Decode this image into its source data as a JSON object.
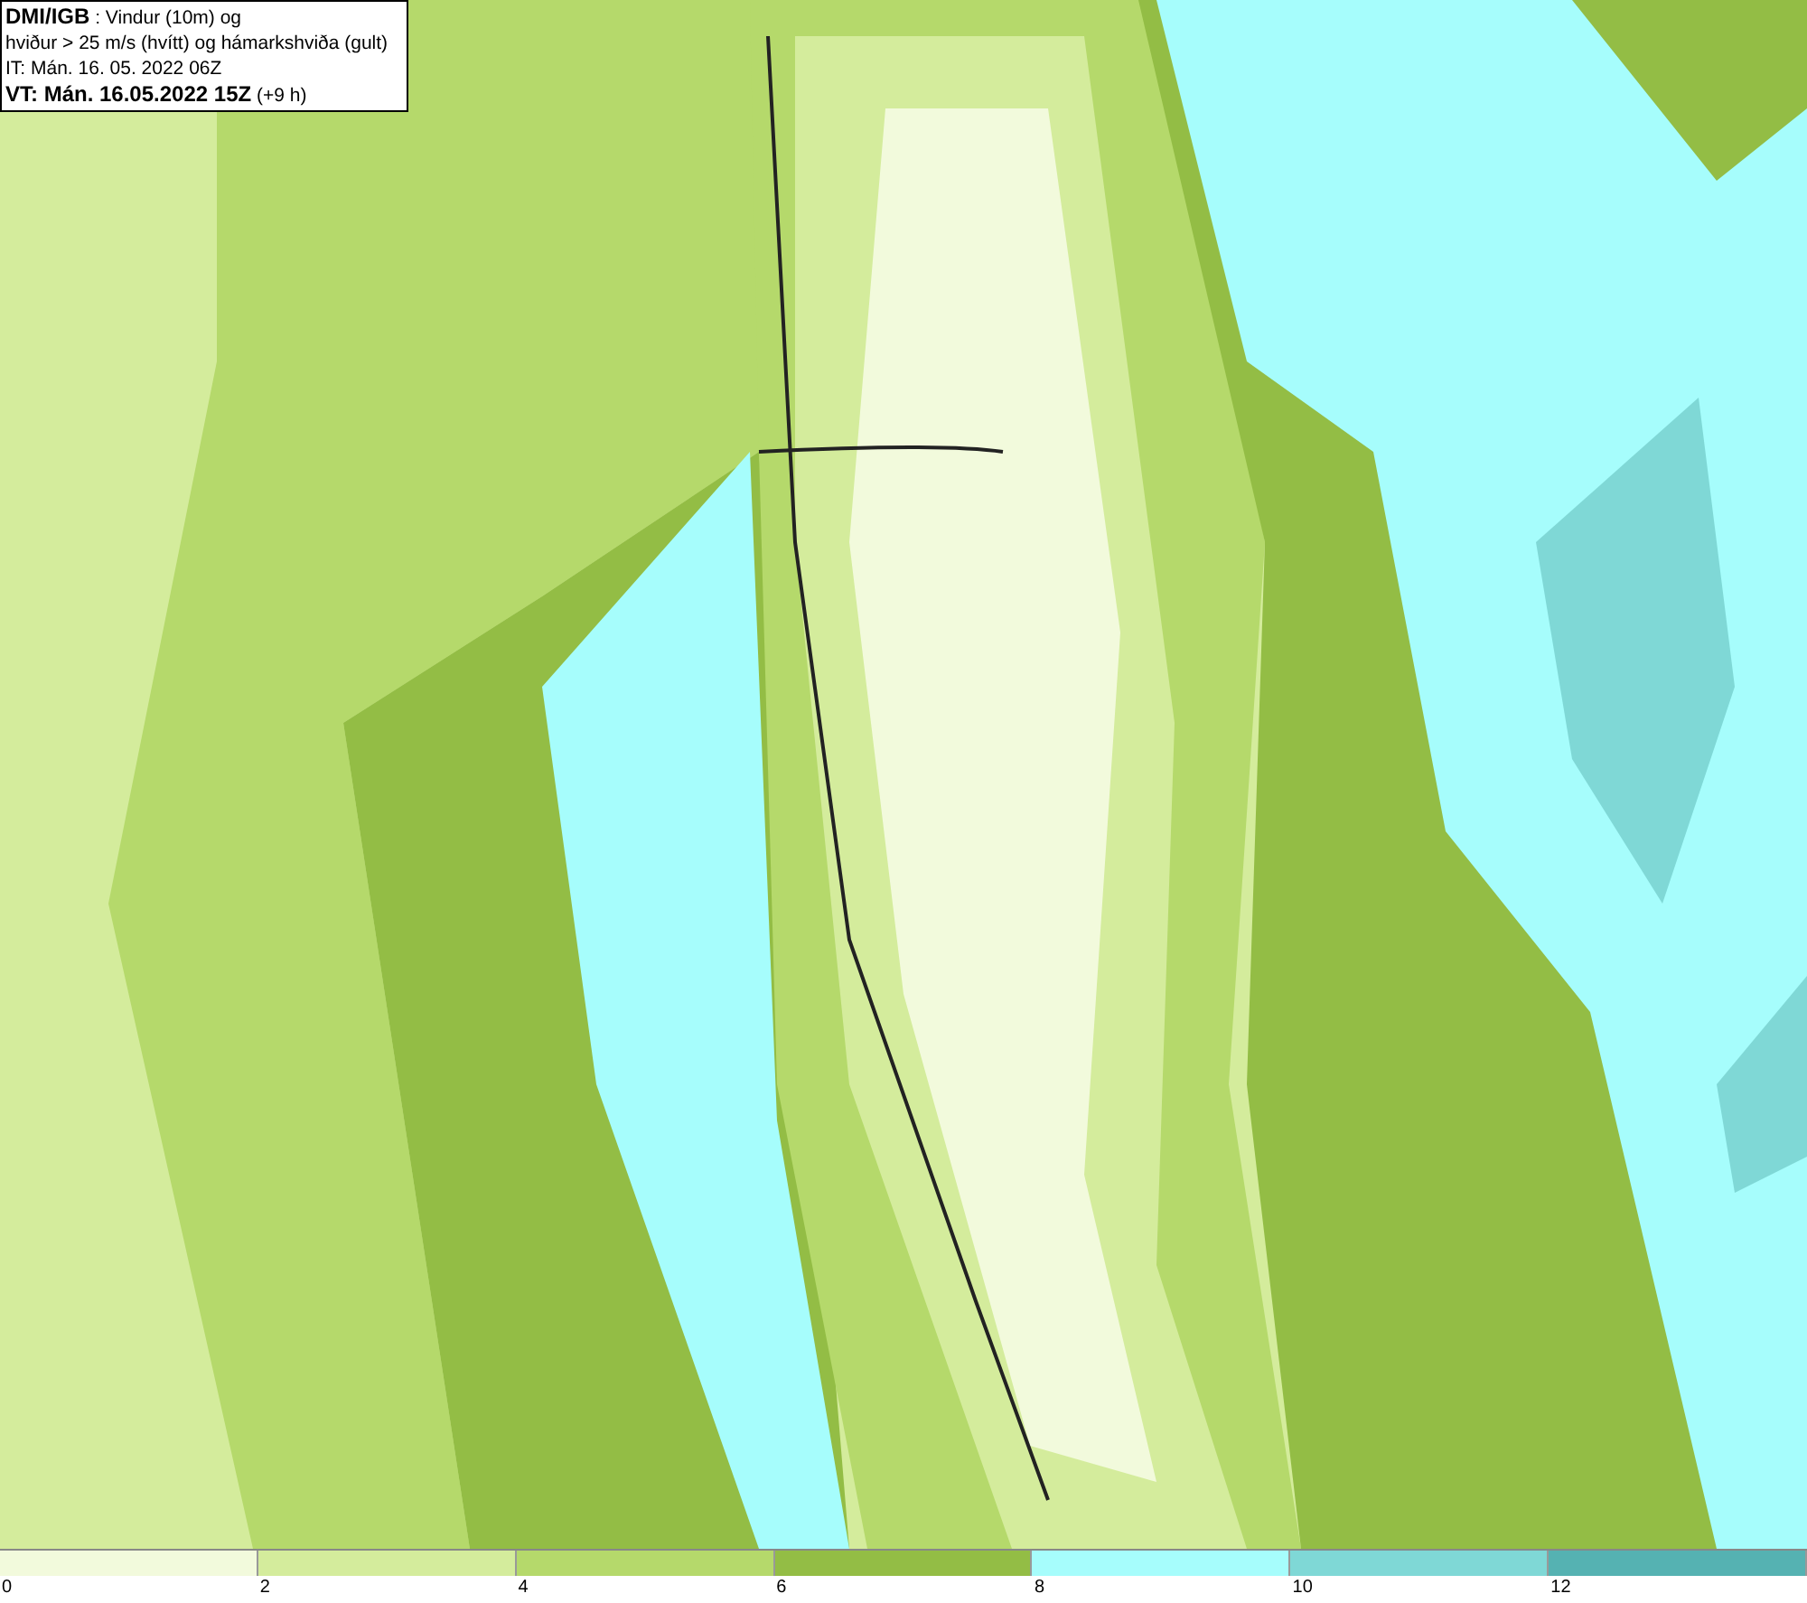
{
  "info_box": {
    "lines": [
      "**DMI/IGB** : Vindur (10m) og",
      "hviður > 25 m/s (hvítt) og hámarkshviða (gult)",
      "IT: Mán. 16. 05. 2022 06Z",
      "**VT: Mán. 16.05.2022 15Z** (+9 h)"
    ]
  },
  "legend": {
    "bins": [
      {
        "label": "0",
        "color": "#f2fadc"
      },
      {
        "label": "2",
        "color": "#d4ec9c"
      },
      {
        "label": "4",
        "color": "#b5d96b"
      },
      {
        "label": "6",
        "color": "#93bd45"
      },
      {
        "label": "8",
        "color": "#a6fdfc"
      },
      {
        "label": "10",
        "color": "#7fd8d6"
      },
      {
        "label": "12",
        "color": "#55b2b2"
      }
    ]
  }
}
